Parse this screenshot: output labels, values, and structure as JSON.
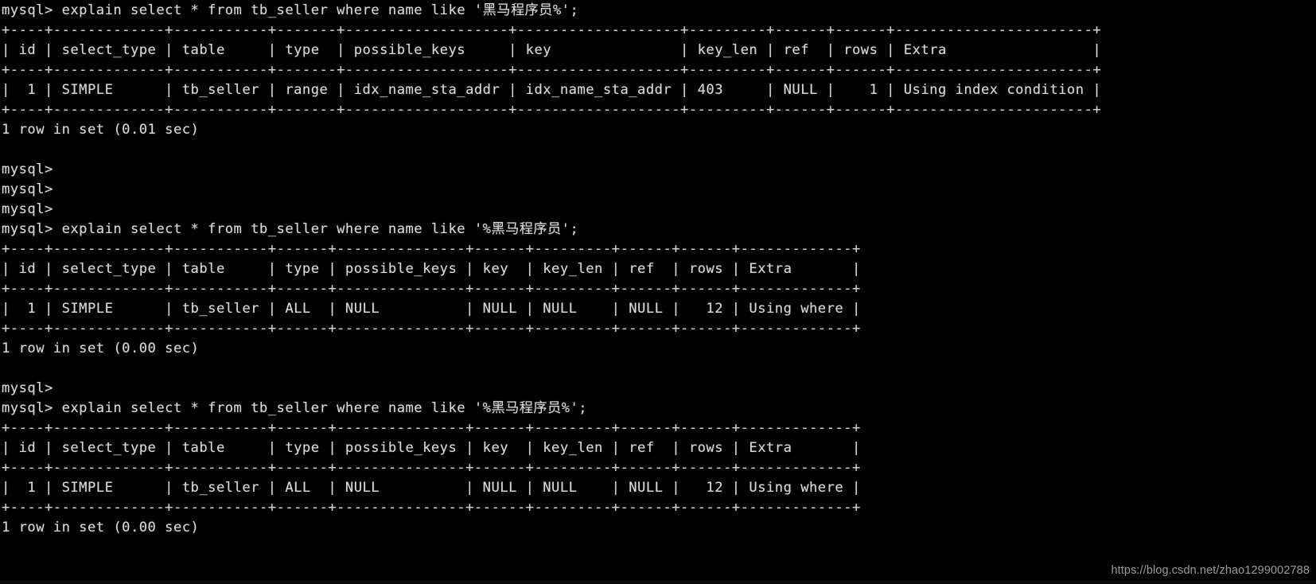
{
  "terminal": {
    "title": "MySQL Terminal",
    "prompt": "mysql>",
    "background_color": "#000000",
    "text_color": "#d8d8d8",
    "watermark": "https://blog.csdn.net/zhao1299002788"
  },
  "lines": [
    "mysql> explain select * from tb_seller where name like '黑马程序员%';",
    "+----+-------------+-----------+-------+-------------------+-------------------+---------+------+------+-----------------------+",
    "| id | select_type | table     | type  | possible_keys     | key               | key_len | ref  | rows | Extra                 |",
    "+----+-------------+-----------+-------+-------------------+-------------------+---------+------+------+-----------------------+",
    "|  1 | SIMPLE      | tb_seller | range | idx_name_sta_addr | idx_name_sta_addr | 403     | NULL |    1 | Using index condition |",
    "+----+-------------+-----------+-------+-------------------+-------------------+---------+------+------+-----------------------+",
    "1 row in set (0.01 sec)",
    "",
    "mysql>",
    "mysql>",
    "mysql>",
    "mysql> explain select * from tb_seller where name like '%黑马程序员';",
    "+----+-------------+-----------+------+---------------+------+---------+------+------+-------------+",
    "| id | select_type | table     | type | possible_keys | key  | key_len | ref  | rows | Extra       |",
    "+----+-------------+-----------+------+---------------+------+---------+------+------+-------------+",
    "|  1 | SIMPLE      | tb_seller | ALL  | NULL          | NULL | NULL    | NULL |   12 | Using where |",
    "+----+-------------+-----------+------+---------------+------+---------+------+------+-------------+",
    "1 row in set (0.00 sec)",
    "",
    "mysql>",
    "mysql> explain select * from tb_seller where name like '%黑马程序员%';",
    "+----+-------------+-----------+------+---------------+------+---------+------+------+-------------+",
    "| id | select_type | table     | type | possible_keys | key  | key_len | ref  | rows | Extra       |",
    "+----+-------------+-----------+------+---------------+------+---------+------+------+-------------+",
    "|  1 | SIMPLE      | tb_seller | ALL  | NULL          | NULL | NULL    | NULL |   12 | Using where |",
    "+----+-------------+-----------+------+---------------+------+---------+------+------+-------------+",
    "1 row in set (0.00 sec)"
  ],
  "queries": [
    {
      "index": 1,
      "command": "explain select * from tb_seller where name like '黑马程序员%';",
      "pattern": "黑马程序员%",
      "pattern_kind": "prefix-match",
      "result_columns": [
        "id",
        "select_type",
        "table",
        "type",
        "possible_keys",
        "key",
        "key_len",
        "ref",
        "rows",
        "Extra"
      ],
      "result_rows": [
        {
          "id": "1",
          "select_type": "SIMPLE",
          "table": "tb_seller",
          "type": "range",
          "possible_keys": "idx_name_sta_addr",
          "key": "idx_name_sta_addr",
          "key_len": "403",
          "ref": "NULL",
          "rows": "1",
          "Extra": "Using index condition"
        }
      ],
      "status": "1 row in set (0.01 sec)"
    },
    {
      "index": 2,
      "command": "explain select * from tb_seller where name like '%黑马程序员';",
      "pattern": "%黑马程序员",
      "pattern_kind": "suffix-match",
      "result_columns": [
        "id",
        "select_type",
        "table",
        "type",
        "possible_keys",
        "key",
        "key_len",
        "ref",
        "rows",
        "Extra"
      ],
      "result_rows": [
        {
          "id": "1",
          "select_type": "SIMPLE",
          "table": "tb_seller",
          "type": "ALL",
          "possible_keys": "NULL",
          "key": "NULL",
          "key_len": "NULL",
          "ref": "NULL",
          "rows": "12",
          "Extra": "Using where"
        }
      ],
      "status": "1 row in set (0.00 sec)"
    },
    {
      "index": 3,
      "command": "explain select * from tb_seller where name like '%黑马程序员%';",
      "pattern": "%黑马程序员%",
      "pattern_kind": "contains-match",
      "result_columns": [
        "id",
        "select_type",
        "table",
        "type",
        "possible_keys",
        "key",
        "key_len",
        "ref",
        "rows",
        "Extra"
      ],
      "result_rows": [
        {
          "id": "1",
          "select_type": "SIMPLE",
          "table": "tb_seller",
          "type": "ALL",
          "possible_keys": "NULL",
          "key": "NULL",
          "key_len": "NULL",
          "ref": "NULL",
          "rows": "12",
          "Extra": "Using where"
        }
      ],
      "status": "1 row in set (0.00 sec)"
    }
  ]
}
